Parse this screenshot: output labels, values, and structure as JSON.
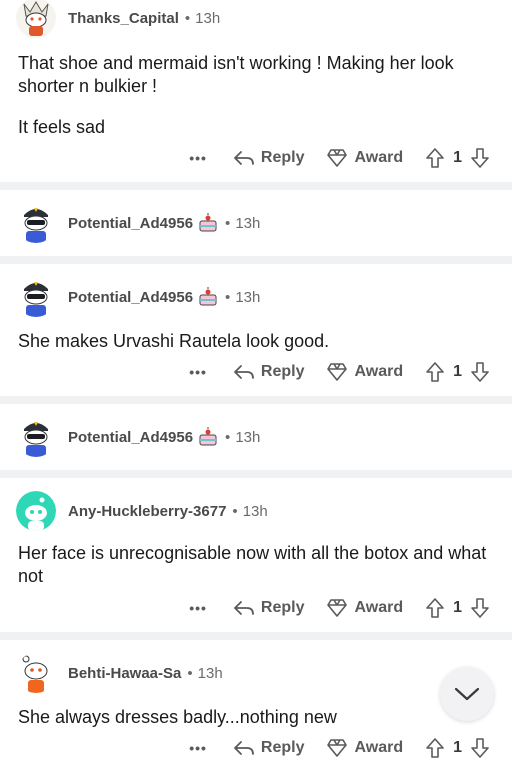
{
  "actions": {
    "more": "•••",
    "reply": "Reply",
    "award": "Award"
  },
  "comments": [
    {
      "username": "Thanks_Capital",
      "dot": "•",
      "time": "13h",
      "paragraphs": [
        "That shoe and mermaid isn't working ! Making her look shorter n bulkier !",
        "It feels sad"
      ],
      "votes": "1",
      "avatar": "snoo-with-headdress"
    },
    {
      "username": "Potential_Ad4956",
      "flair": "cake-icon",
      "dot": "•",
      "time": "13h",
      "paragraphs": [],
      "avatar": "snoo-with-cap-and-sunglasses"
    },
    {
      "username": "Potential_Ad4956",
      "flair": "cake-icon",
      "dot": "•",
      "time": "13h",
      "paragraphs": [
        "She makes Urvashi Rautela look good."
      ],
      "votes": "1",
      "avatar": "snoo-with-cap-and-sunglasses"
    },
    {
      "username": "Potential_Ad4956",
      "flair": "cake-icon",
      "dot": "•",
      "time": "13h",
      "paragraphs": [],
      "avatar": "snoo-with-cap-and-sunglasses"
    },
    {
      "username": "Any-Huckleberry-3677",
      "dot": "•",
      "time": "13h",
      "paragraphs": [
        "Her face is unrecognisable now with all the botox and what not"
      ],
      "votes": "1",
      "avatar": "default-snoo-teal"
    },
    {
      "username": "Behti-Hawaa-Sa",
      "dot": "•",
      "time": "13h",
      "paragraphs": [
        "She always dresses badly...nothing new"
      ],
      "votes": "1",
      "avatar": "snoo-orange-shirt"
    }
  ],
  "colors": {
    "separator": "#f0f1f3",
    "text": "#1a1a1b",
    "meta": "#6b6b6e"
  }
}
